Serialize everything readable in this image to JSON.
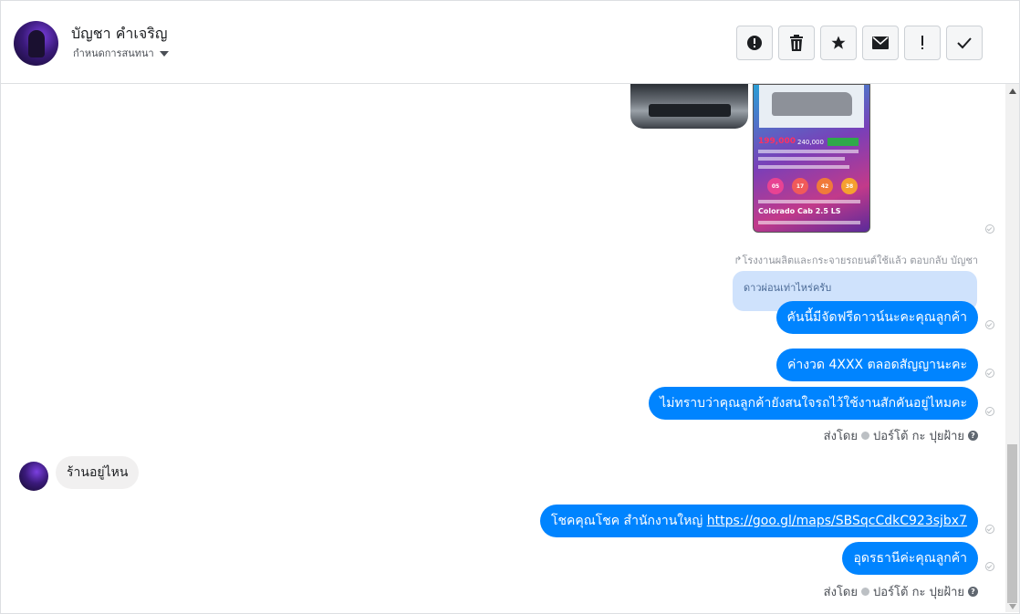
{
  "header": {
    "contact_name": "บัญชา คำเจริญ",
    "assign_label": "กำหนดการสนทนา",
    "actions": [
      {
        "name": "alert-button",
        "icon": "exclamation-circle-icon"
      },
      {
        "name": "delete-button",
        "icon": "trash-icon"
      },
      {
        "name": "star-button",
        "icon": "star-icon"
      },
      {
        "name": "mark-unread-button",
        "icon": "envelope-icon"
      },
      {
        "name": "spam-button",
        "icon": "exclamation-icon"
      },
      {
        "name": "done-button",
        "icon": "checkmark-icon"
      }
    ]
  },
  "conversation": {
    "image_card": {
      "price": "199,000",
      "price_alt": "240,000",
      "numbers": [
        "05",
        "17",
        "42",
        "38"
      ],
      "model": "Colorado Cab 2.5 LS"
    },
    "reply_note": "↱โรงงานผลิตและกระจายรถยนต์ใช้แล้ว ตอบกลับ บัญชา",
    "quoted_text": "ดาวผ่อนเท่าไหร่ครับ",
    "messages_out_1": [
      "คันนี้มีจัดฟรีดาวน์นะคะคุณลูกค้า",
      "ค่างวด 4XXX  ตลอดสัญญานะคะ",
      "ไม่ทราบว่าคุณลูกค้ายังสนใจรถไว้ใช้งานสักคันอยู่ไหมคะ"
    ],
    "sent_by_1": {
      "prefix": "ส่งโดย",
      "agent": "ปอร์โต้ กะ ปุยฝ้าย"
    },
    "message_in": "ร้านอยู่ไหน",
    "message_out_link": {
      "text": "โชคคุณโชค สำนักงานใหญ่ ",
      "url": "https://goo.gl/maps/SBSqcCdkC923sjbx7"
    },
    "message_out_last": "อุดรธานีค่ะคุณลูกค้า",
    "sent_by_2": {
      "prefix": "ส่งโดย",
      "agent": "ปอร์โต้ กะ ปุยฝ้าย"
    }
  },
  "colors": {
    "outgoing_bubble": "#0084ff",
    "incoming_bubble": "#f1f0f0",
    "quote_bubble": "#cfe2fc"
  }
}
